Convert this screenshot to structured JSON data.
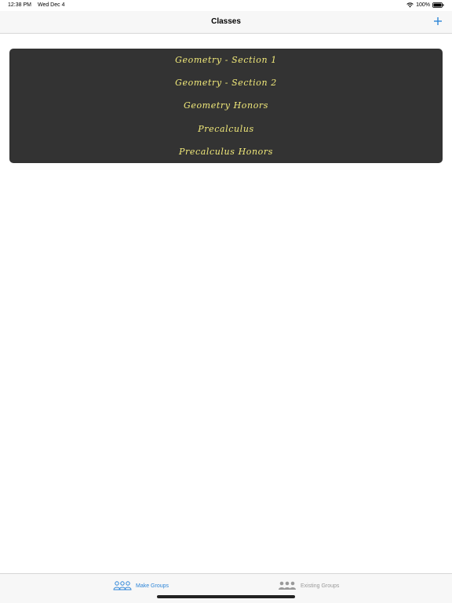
{
  "status": {
    "time": "12:38 PM",
    "date": "Wed Dec 4",
    "battery": "100%"
  },
  "nav": {
    "title": "Classes",
    "add_icon": "plus-icon"
  },
  "classes": [
    {
      "label": "Geometry - Section 1"
    },
    {
      "label": "Geometry - Section 2"
    },
    {
      "label": "Geometry Honors"
    },
    {
      "label": "Precalculus"
    },
    {
      "label": "Precalculus Honors"
    }
  ],
  "tabs": [
    {
      "label": "Make Groups",
      "icon": "people-outline-icon",
      "selected": true
    },
    {
      "label": "Existing Groups",
      "icon": "people-filled-icon",
      "selected": false
    }
  ],
  "colors": {
    "accent": "#2f86d8",
    "list_bg": "#333333",
    "list_text": "#f2ea7a"
  }
}
